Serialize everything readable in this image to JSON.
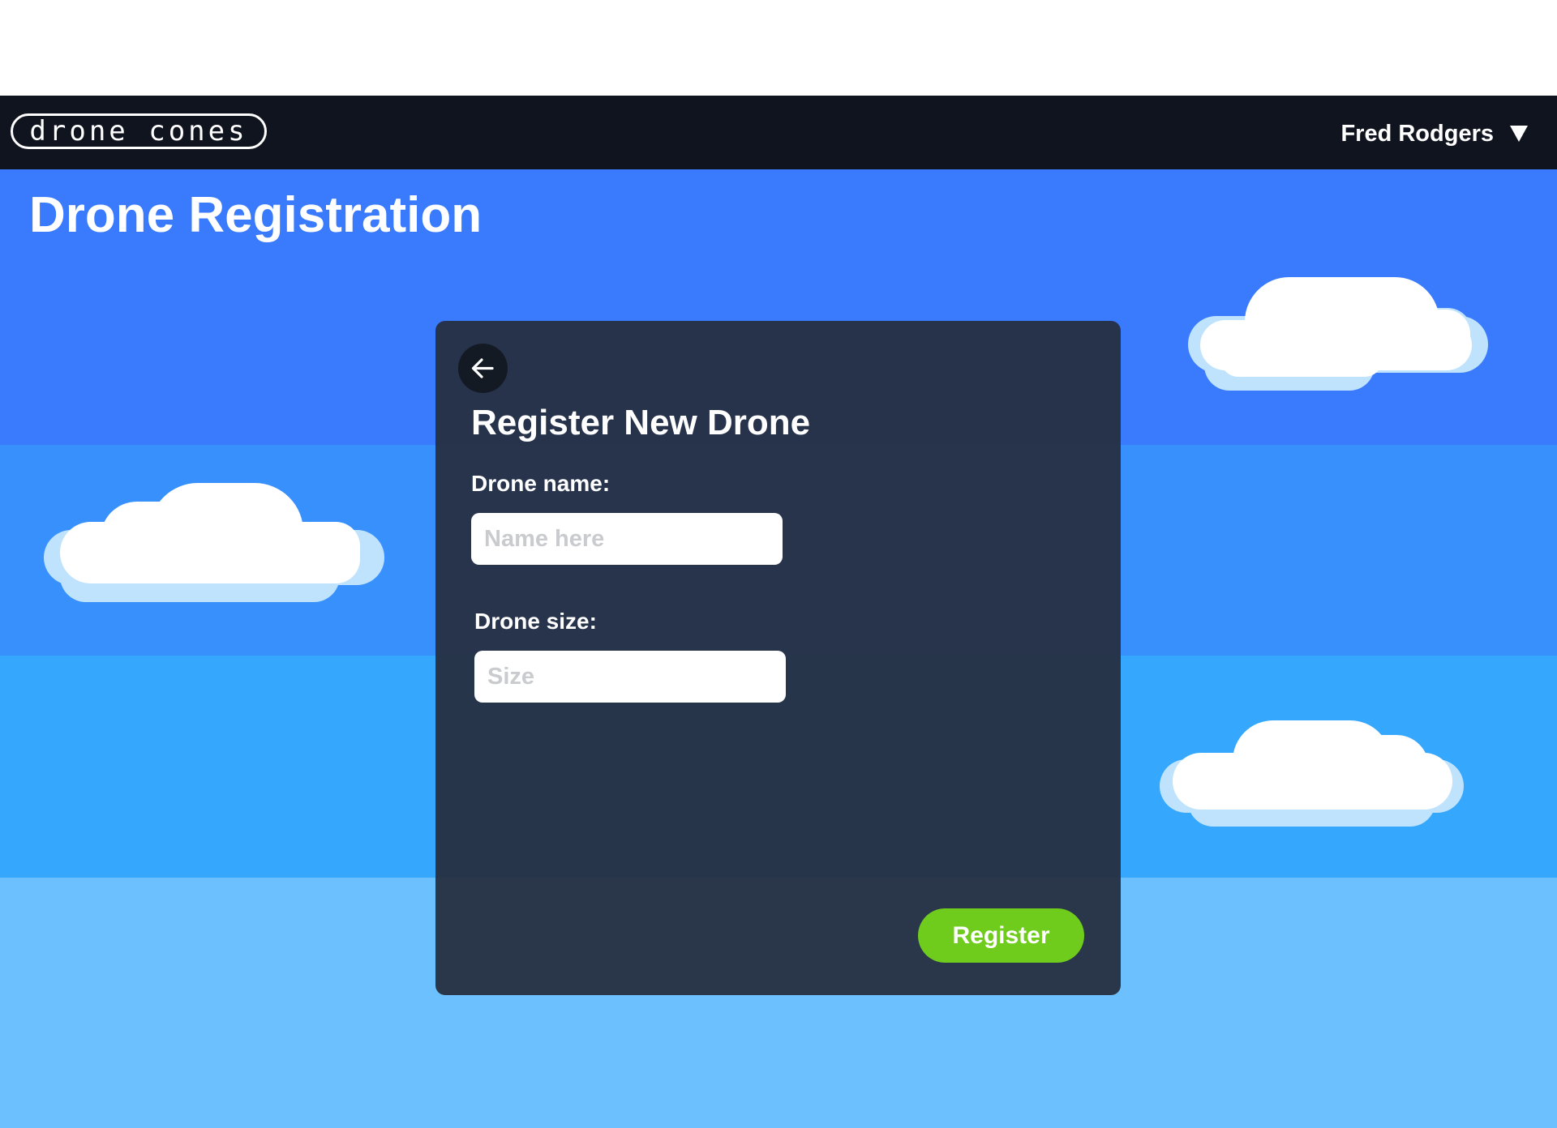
{
  "brand": {
    "logo_text": "drone cones"
  },
  "user_menu": {
    "name": "Fred Rodgers",
    "icon": "caret-down-icon"
  },
  "page": {
    "title": "Drone Registration"
  },
  "form": {
    "back_icon": "arrow-left-icon",
    "title": "Register New Drone",
    "name_label": "Drone name:",
    "name_placeholder": "Name here",
    "name_value": "",
    "size_label": "Drone size:",
    "size_placeholder": "Size",
    "size_value": "",
    "submit_label": "Register"
  },
  "colors": {
    "navbar": "#10141f",
    "sky_band_1": "#3a7bfe",
    "sky_band_2": "#3890fd",
    "sky_band_3": "#35a8fe",
    "sky_band_4": "#6bc0fd",
    "card": "#262e40",
    "accent_green": "#6fcc1c",
    "cloud_white": "#ffffff",
    "cloud_shadow": "#bfe3fd"
  }
}
